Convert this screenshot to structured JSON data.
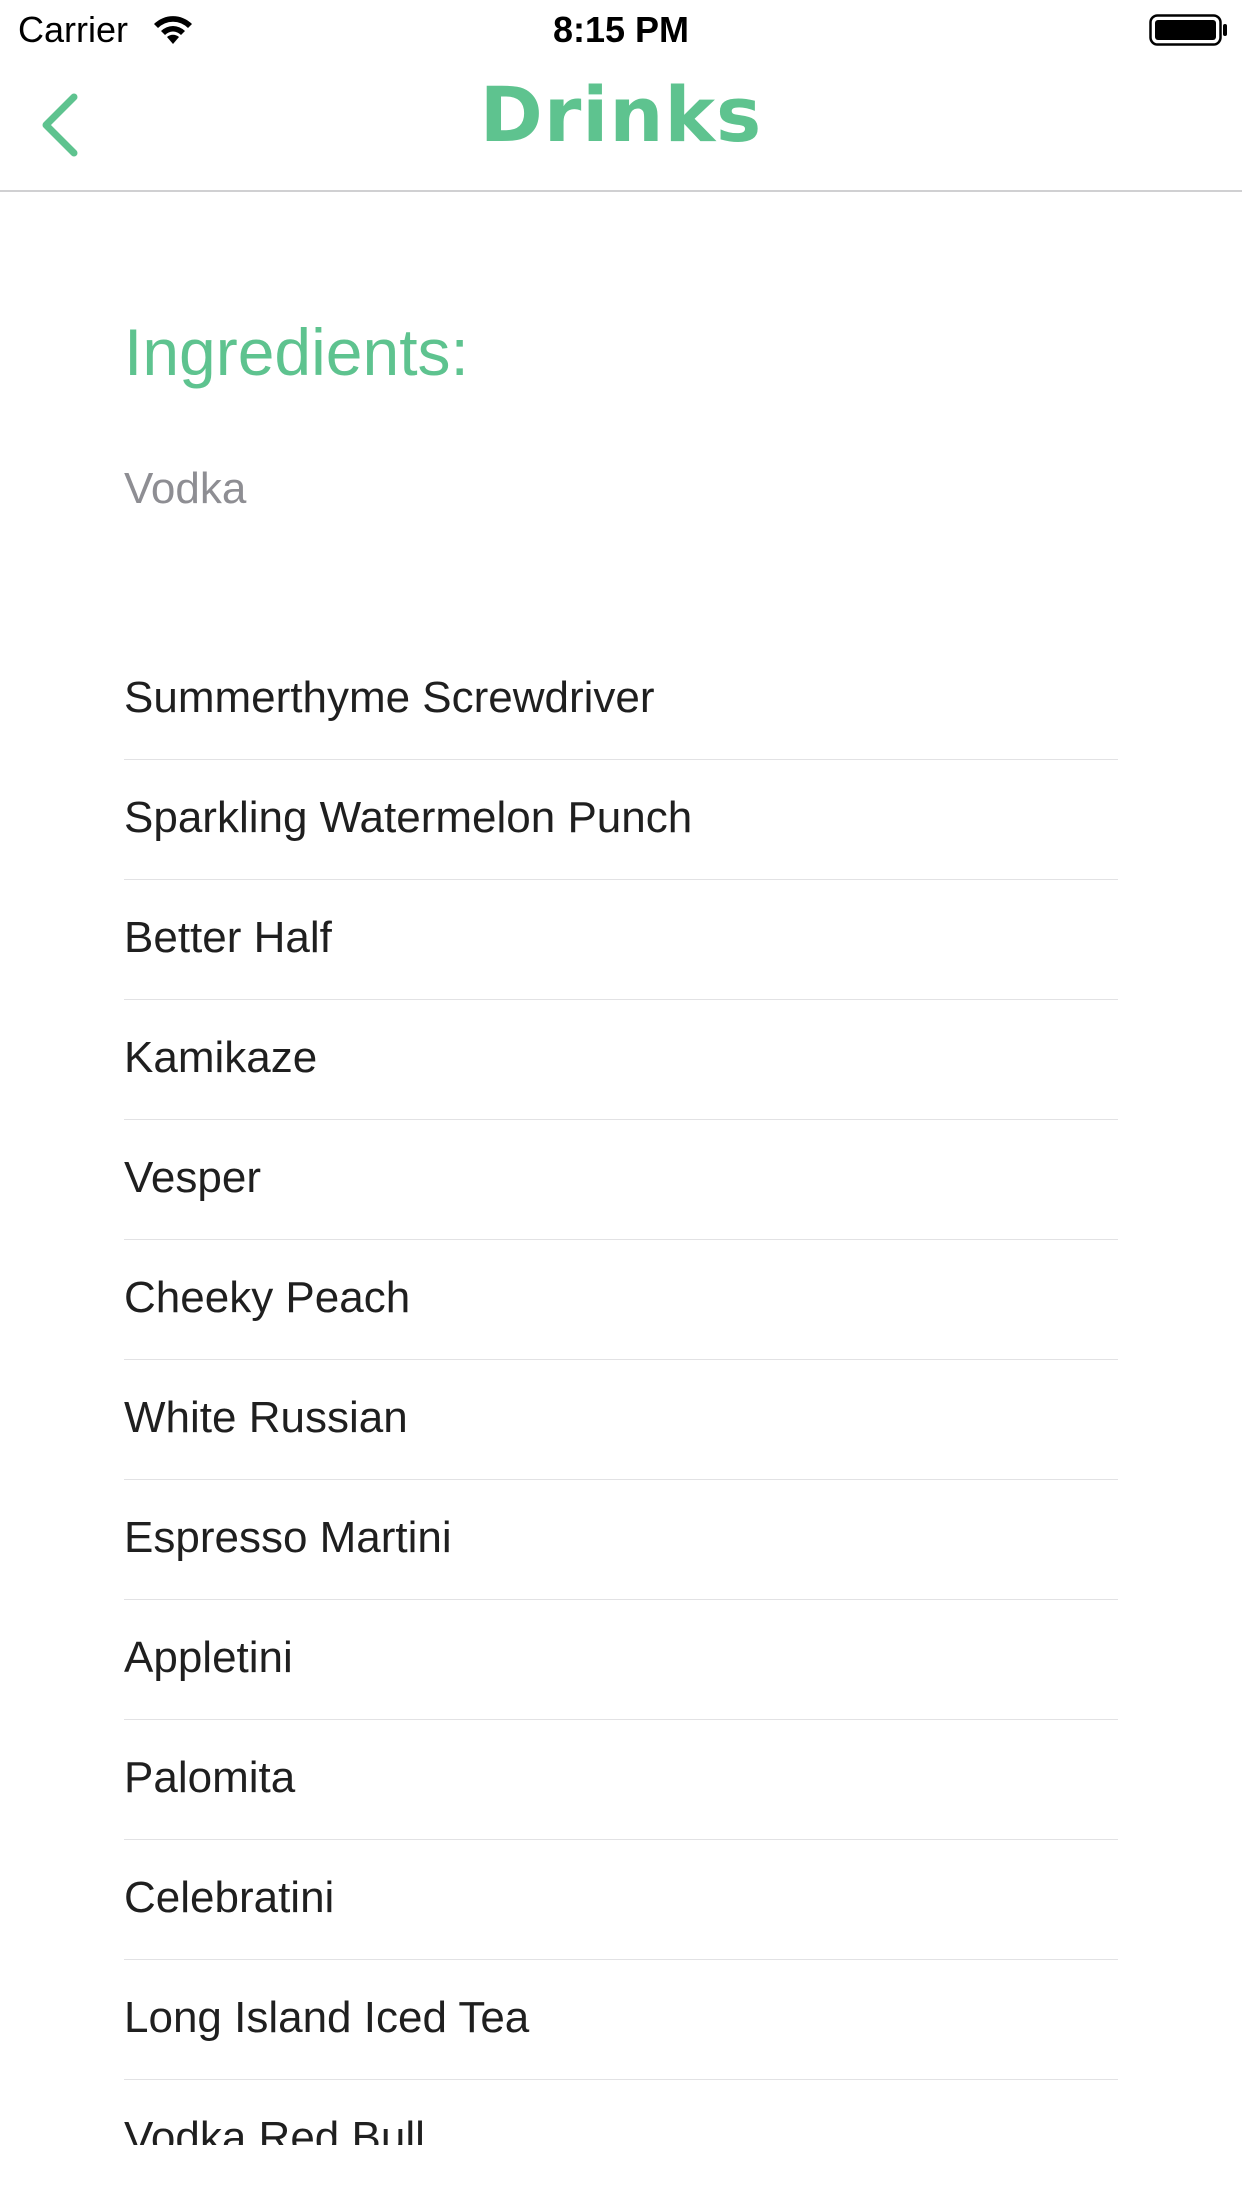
{
  "status_bar": {
    "carrier": "Carrier",
    "time": "8:15 PM"
  },
  "nav": {
    "title": "Drinks",
    "back_icon": "chevron-left-icon"
  },
  "ingredients": {
    "heading": "Ingredients:",
    "value": "Vodka"
  },
  "drinks": [
    "Summerthyme Screwdriver",
    "Sparkling Watermelon Punch",
    "Better Half",
    "Kamikaze",
    "Vesper",
    "Cheeky Peach",
    "White Russian",
    "Espresso Martini",
    "Appletini",
    "Palomita",
    "Celebratini",
    "Long Island Iced Tea",
    "Vodka Red Bull"
  ],
  "colors": {
    "accent": "#5ec38f",
    "secondary_text": "#8e8e93",
    "separator": "#e2e2e4"
  }
}
